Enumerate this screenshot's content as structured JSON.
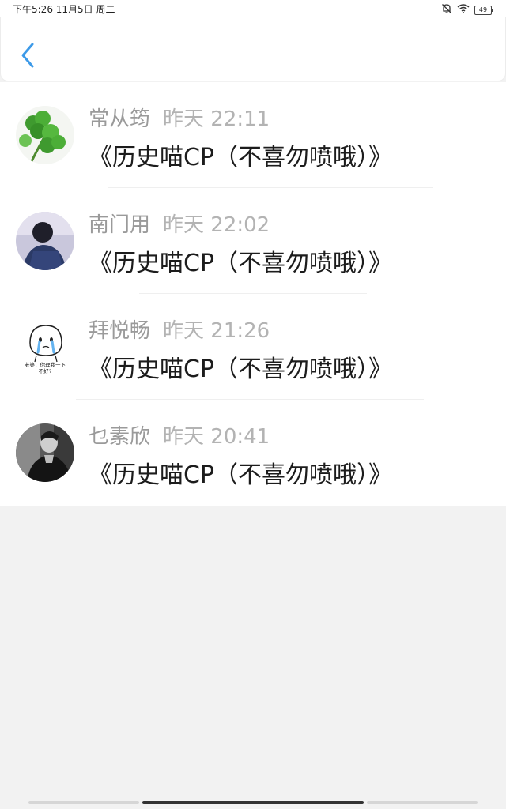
{
  "status_bar": {
    "time_text": "下午5:26 11月5日 周二",
    "battery": "49",
    "icons": [
      "mute-bell-icon",
      "wifi-icon",
      "battery-icon"
    ]
  },
  "header": {
    "back_icon": "chevron-left-icon",
    "accent_color": "#3d9ae8"
  },
  "comments": [
    {
      "name": "常从筠",
      "time": "昨天 22:11",
      "text": "《历史喵CP（不喜勿喷哦）》",
      "avatar": "clover-avatar"
    },
    {
      "name": "南门用",
      "time": "昨天 22:02",
      "text": "《历史喵CP（不喜勿喷哦）》",
      "avatar": "person-photo-avatar"
    },
    {
      "name": "拜悦畅",
      "time": "昨天 21:26",
      "text": "《历史喵CP（不喜勿喷哦）》",
      "avatar": "crying-cartoon-avatar"
    },
    {
      "name": "乜素欣",
      "time": "昨天 20:41",
      "text": "《历史喵CP（不喜勿喷哦）》",
      "avatar": "bw-portrait-avatar"
    }
  ],
  "avatar_sticker_text": "老婆，你理我一下 不好?"
}
